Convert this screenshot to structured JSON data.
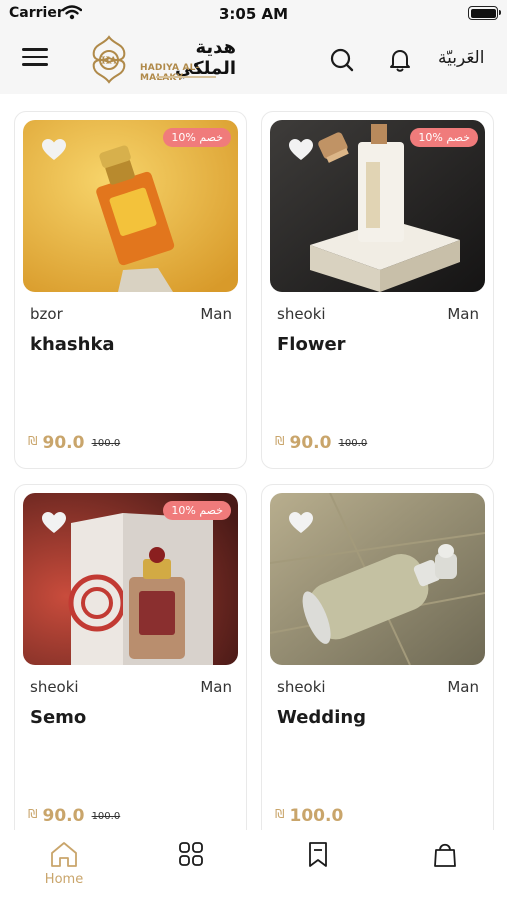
{
  "status": {
    "carrier": "Carrier",
    "time": "3:05 AM"
  },
  "header": {
    "logo_ar": "هدية الملكي",
    "logo_en": "HADIYA AL-MALAKY",
    "language": "العَربيّة"
  },
  "icons": {
    "menu": "hamburger-menu-icon",
    "search": "search-icon",
    "bell": "bell-icon",
    "heart": "heart-icon",
    "home": "home-icon",
    "grid": "grid-icon",
    "bookmark": "bookmark-icon",
    "bag": "shopping-bag-icon"
  },
  "colors": {
    "accent": "#c9a56b",
    "badge": "#f07b7b"
  },
  "products": [
    {
      "badge": "10% خصم",
      "brand": "bzor",
      "gender": "Man",
      "name": "khashka",
      "currency": "₪",
      "price": "90.0",
      "old_price": "100.0"
    },
    {
      "badge": "10% خصم",
      "brand": "sheoki",
      "gender": "Man",
      "name": "Flower",
      "currency": "₪",
      "price": "90.0",
      "old_price": "100.0"
    },
    {
      "badge": "10% خصم",
      "brand": "sheoki",
      "gender": "Man",
      "name": "Semo",
      "currency": "₪",
      "price": "90.0",
      "old_price": "100.0"
    },
    {
      "badge": "",
      "brand": "sheoki",
      "gender": "Man",
      "name": "Wedding",
      "currency": "₪",
      "price": "100.0",
      "old_price": ""
    }
  ],
  "tabbar": {
    "home_label": "Home"
  }
}
